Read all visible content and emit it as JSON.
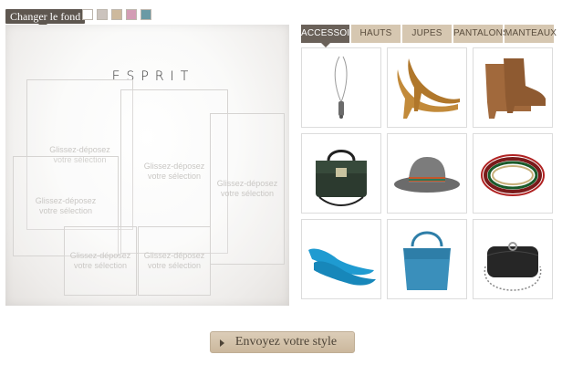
{
  "background_changer": {
    "label": "Changer le fond",
    "swatches": [
      "#ffffff",
      "#cbc3bd",
      "#cdb99d",
      "#d39db5",
      "#6a9aa5"
    ]
  },
  "canvas": {
    "logo": "ESPRIT",
    "drop_zone_text": "Glissez-déposez\nvotre sélection"
  },
  "tabs": [
    {
      "label": "ACCESSOIRES",
      "active": true
    },
    {
      "label": "HAUTS",
      "active": false
    },
    {
      "label": "JUPES",
      "active": false
    },
    {
      "label": "PANTALONS",
      "active": false
    },
    {
      "label": "MANTEAUX",
      "active": false
    }
  ],
  "products": [
    {
      "name": "necklace",
      "icon": "necklace-icon"
    },
    {
      "name": "tan-pumps",
      "icon": "high-heel-icon"
    },
    {
      "name": "ankle-boots",
      "icon": "ankle-boot-icon"
    },
    {
      "name": "black-satchel",
      "icon": "satchel-icon"
    },
    {
      "name": "grey-fedora",
      "icon": "fedora-icon"
    },
    {
      "name": "wrap-bracelet",
      "icon": "bracelet-icon"
    },
    {
      "name": "blue-flats",
      "icon": "flat-shoe-icon"
    },
    {
      "name": "blue-handbag",
      "icon": "handbag-icon"
    },
    {
      "name": "black-clutch",
      "icon": "clutch-icon"
    }
  ],
  "send_button": {
    "label": "Envoyez votre style"
  }
}
